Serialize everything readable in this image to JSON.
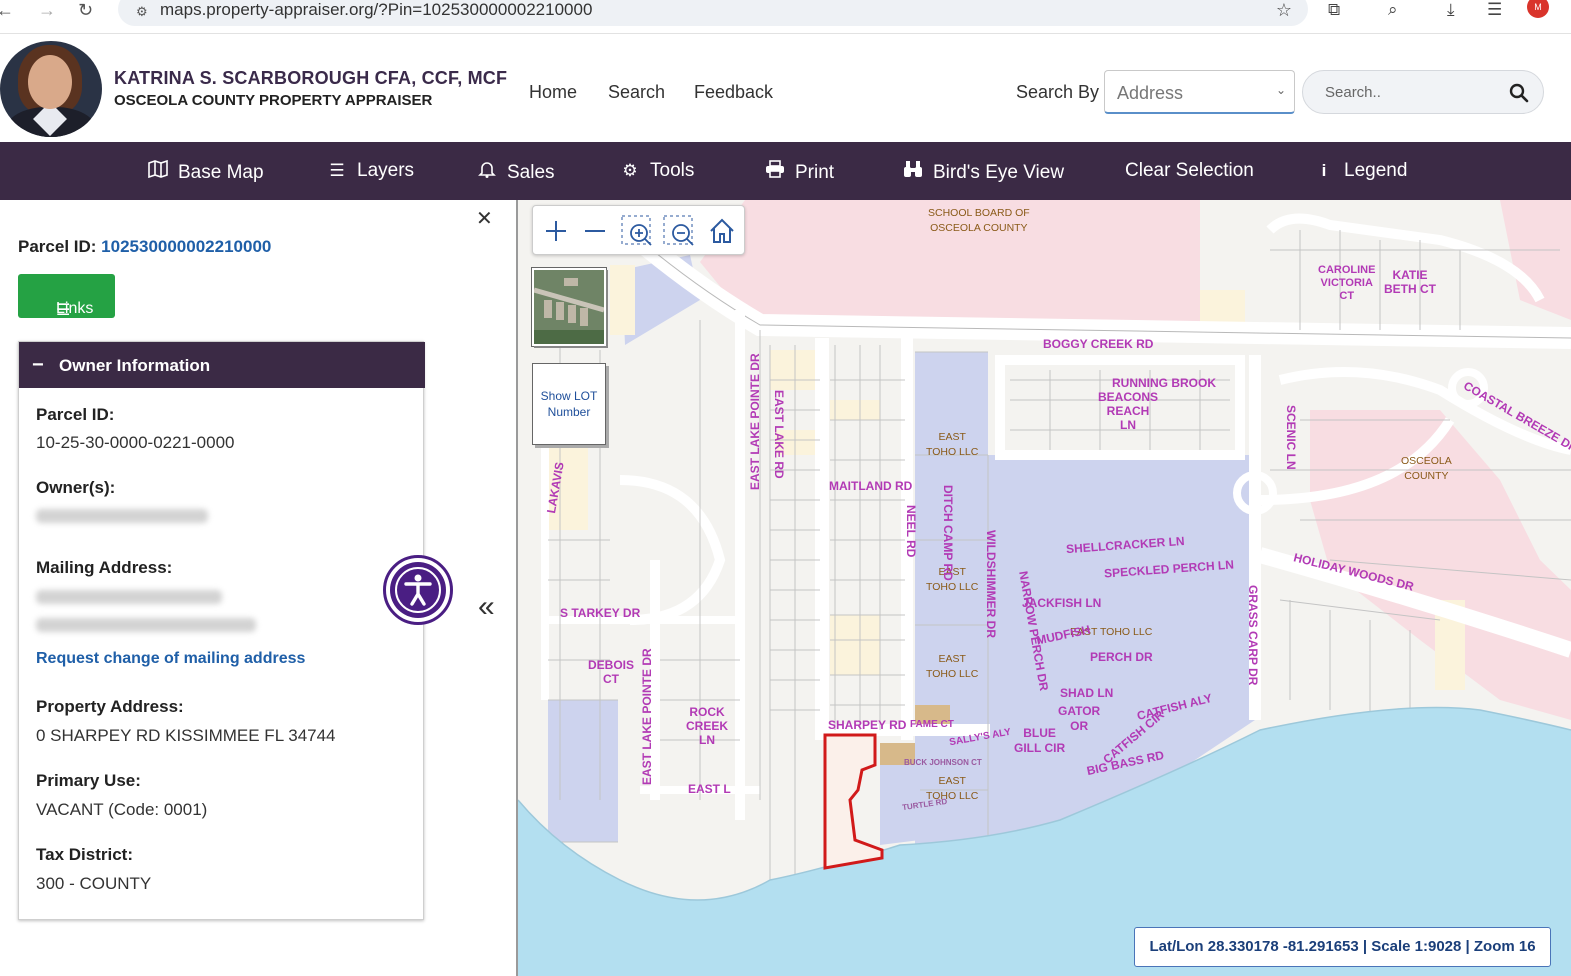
{
  "browser": {
    "url": "maps.property-appraiser.org/?Pin=102530000002210000",
    "back": "←",
    "forward": "→",
    "reload": "↻",
    "star": "☆"
  },
  "header": {
    "name_line": "KATRINA S. SCARBOROUGH CFA, CCF, MCF",
    "org_line": "OSCEOLA COUNTY PROPERTY APPRAISER",
    "nav": [
      "Home",
      "Search",
      "Feedback"
    ],
    "search_by_label": "Search By",
    "search_by_value": "Address",
    "search_placeholder": "Search.."
  },
  "toolbar": {
    "items": [
      {
        "label": "Base Map",
        "icon": "map-icon"
      },
      {
        "label": "Layers",
        "icon": "list-icon"
      },
      {
        "label": "Sales",
        "icon": "bell-icon"
      },
      {
        "label": "Tools",
        "icon": "gear-icon"
      },
      {
        "label": "Print",
        "icon": "printer-icon"
      },
      {
        "label": "Bird's Eye View",
        "icon": "binoculars-icon"
      },
      {
        "label": "Clear Selection",
        "icon": ""
      },
      {
        "label": "Legend",
        "icon": "info-icon"
      }
    ]
  },
  "panel": {
    "parcel_label": "Parcel ID:",
    "parcel_id": "102530000002210000",
    "links_label": "Links",
    "owner_header": "Owner Information",
    "fields": {
      "parcel_label": "Parcel ID:",
      "parcel_value": "10-25-30-0000-0221-0000",
      "owners_label": "Owner(s):",
      "mailing_label": "Mailing Address:",
      "request_link": "Request change of mailing address",
      "property_label": "Property Address:",
      "property_value": "0 SHARPEY RD KISSIMMEE FL 34744",
      "use_label": "Primary Use:",
      "use_value": "VACANT (Code: 0001)",
      "tax_label": "Tax District:",
      "tax_value": "300 - COUNTY"
    }
  },
  "map": {
    "show_lot_label": "Show LOT Number",
    "status": "Lat/Lon 28.330178 -81.291653 | Scale 1:9028 | Zoom 16",
    "owner_labels": {
      "school_board": "SCHOOL BOARD OF\nOSCEOLA COUNTY",
      "east_toho_1": "EAST\nTOHO LLC",
      "east_toho_2": "EAST\nTOHO LLC",
      "east_toho_3": "EAST\nTOHO LLC",
      "east_toho_4": "EAST\nTOHO LLC",
      "east_toho_5": "EAST TOHO LLC",
      "osceola_county": "OSCEOLA\nCOUNTY"
    },
    "streets": {
      "boggy_creek": "BOGGY CREEK RD",
      "maitland": "MAITLAND RD",
      "east_lake_rd": "EAST LAKE RD",
      "neel": "NEEL RD",
      "ditch_camp": "DITCH CAMP RD",
      "wildshimmer": "WILDSHIMMER DR",
      "narrow": "NARROW PERCH DR",
      "shellcracker": "SHELLCRACKER LN",
      "speckled": "SPECKLED PERCH LN",
      "jackfish": "JACKFISH LN",
      "mudfish": "MUDFISH",
      "perch": "PERCH DR",
      "shad": "SHAD LN",
      "gator": "GATOR\nOR",
      "catfish_cir": "CATFISH CIR",
      "catfish_aly": "CATFISH ALY",
      "blue_gill": "BLUE\nGILL CIR",
      "big_bass": "BIG BASS RD",
      "sharpey": "SHARPEY RD",
      "fame": "FAME CT",
      "sallys": "SALLY'S ALY",
      "grass_carp": "GRASS CARP DR",
      "holiday": "HOLIDAY WOODS DR",
      "coastal": "COASTAL BREEZE DR",
      "scenic": "SCENIC LN",
      "running_brook": "RUNNING BROOK",
      "beacons": "BEACONS\nREACH\nLN",
      "caroline": "CAROLINE\nVICTORIA\nCT",
      "katie": "KATIE\nBETH CT",
      "starkey": "S TARKEY DR",
      "debois": "DEBOIS\nCT",
      "rock_creek": "ROCK\nCREEK\nLN",
      "east_l": "EAST L",
      "east_lake_pointe_1": "EAST LAKE POINTE DR",
      "east_lake_pointe_2": "EAST LAKE POINTE DR",
      "lakavis": "LAKAVIS",
      "buck": "BUCK JOHNSON CT",
      "turtle": "TURTLE RD"
    }
  },
  "colors": {
    "toolbar_bg": "#3b2a45",
    "links_green": "#25a244",
    "link_blue": "#1f5fa8",
    "water": "#b3dff0",
    "public_land": "#cdd3ee",
    "school_land": "#f8dde2",
    "parcel_outline": "#d11a1a"
  }
}
